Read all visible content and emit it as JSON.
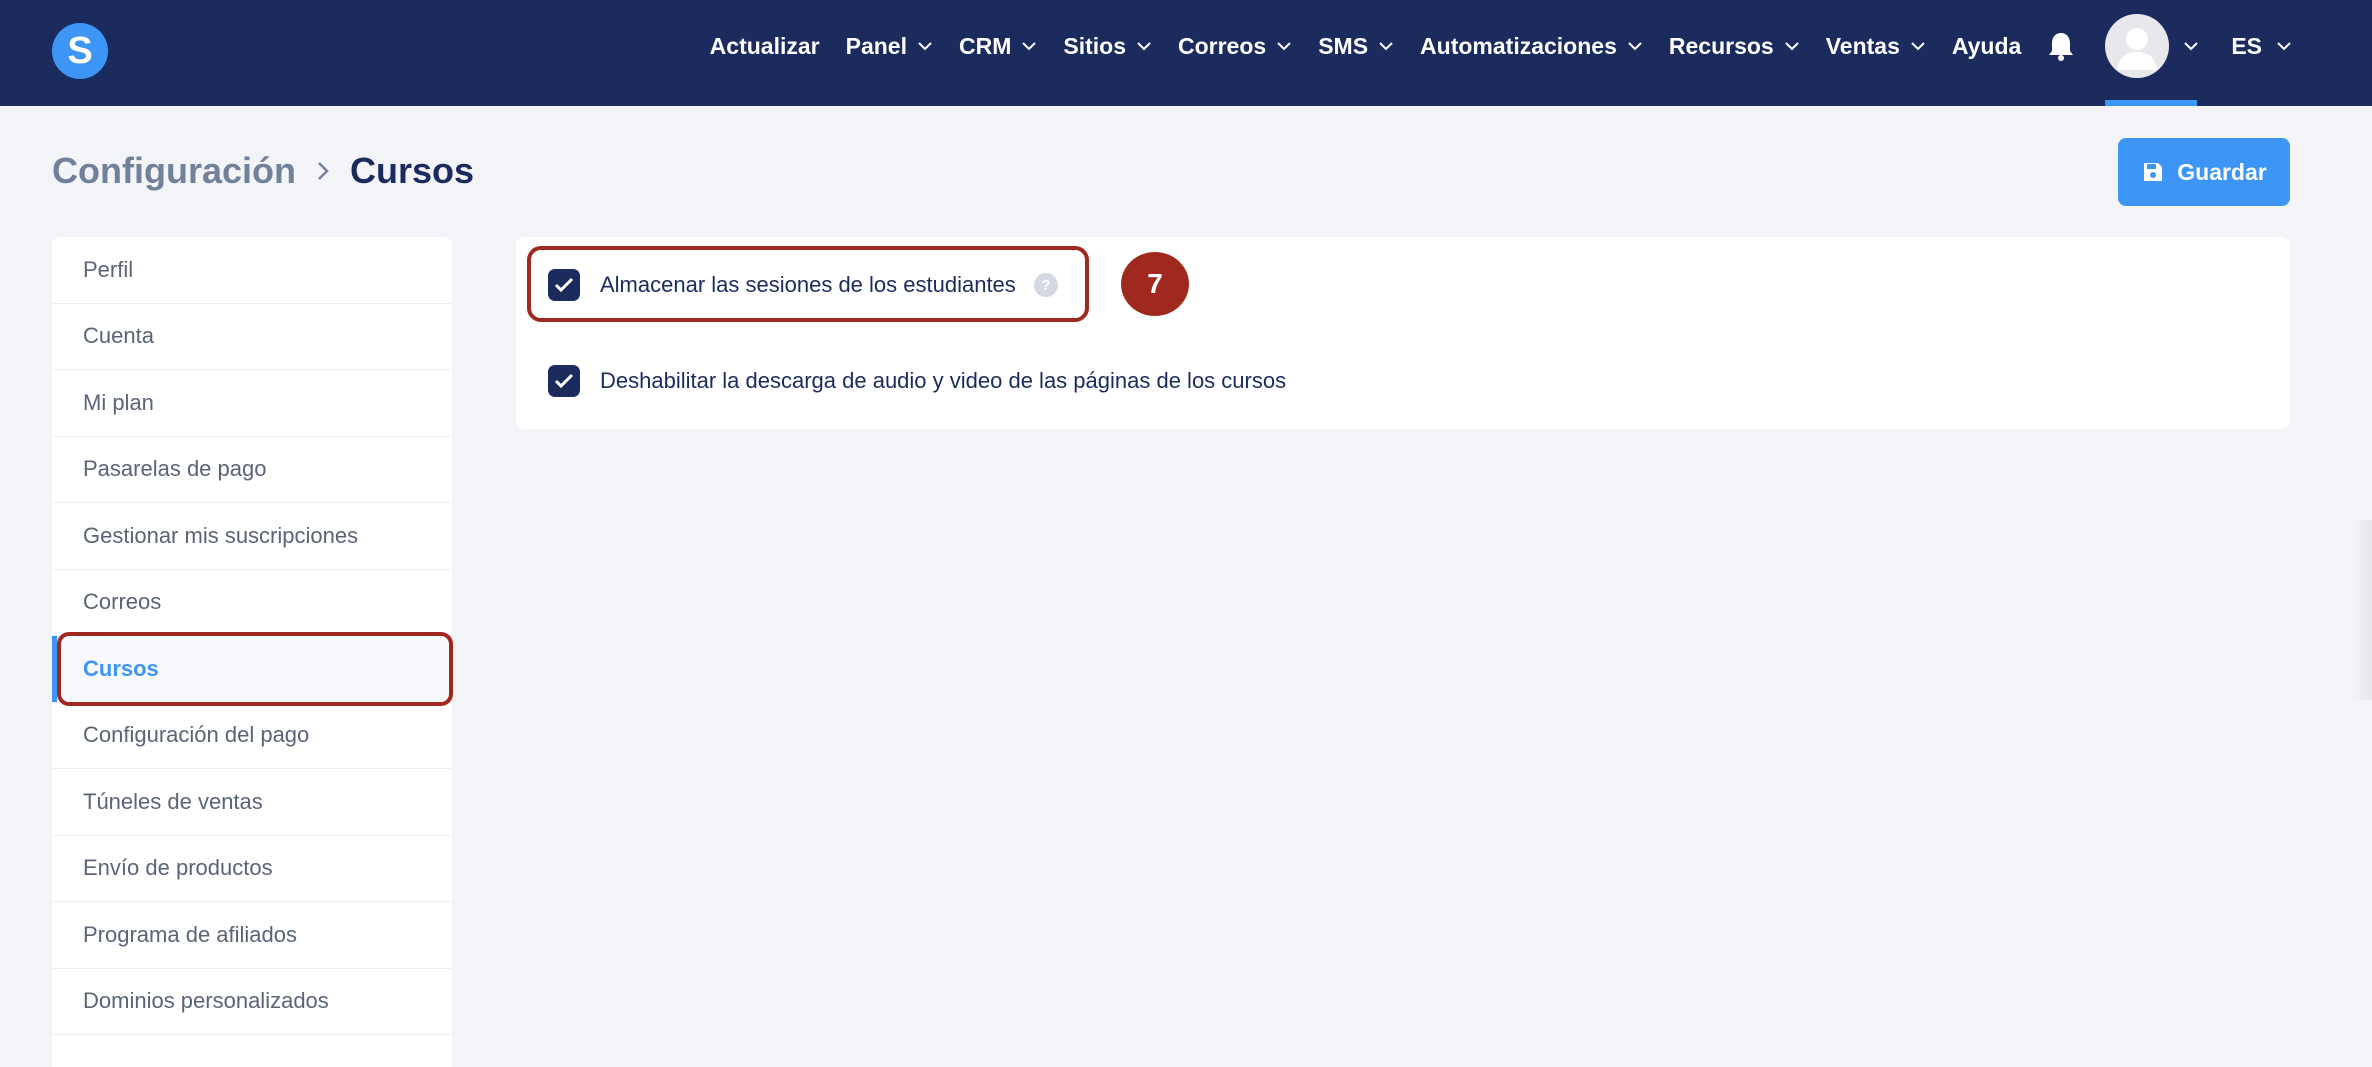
{
  "app": {
    "logo_letter": "S"
  },
  "navbar": {
    "items": [
      {
        "label": "Actualizar",
        "dropdown": false
      },
      {
        "label": "Panel",
        "dropdown": true
      },
      {
        "label": "CRM",
        "dropdown": true
      },
      {
        "label": "Sitios",
        "dropdown": true
      },
      {
        "label": "Correos",
        "dropdown": true
      },
      {
        "label": "SMS",
        "dropdown": true
      },
      {
        "label": "Automatizaciones",
        "dropdown": true
      },
      {
        "label": "Recursos",
        "dropdown": true
      },
      {
        "label": "Ventas",
        "dropdown": true
      },
      {
        "label": "Ayuda",
        "dropdown": false
      }
    ],
    "language": "ES"
  },
  "header": {
    "breadcrumb_parent": "Configuración",
    "breadcrumb_current": "Cursos",
    "save_label": "Guardar"
  },
  "sidebar": {
    "items": [
      {
        "label": "Perfil",
        "active": false
      },
      {
        "label": "Cuenta",
        "active": false
      },
      {
        "label": "Mi plan",
        "active": false
      },
      {
        "label": "Pasarelas de pago",
        "active": false
      },
      {
        "label": "Gestionar mis suscripciones",
        "active": false
      },
      {
        "label": "Correos",
        "active": false
      },
      {
        "label": "Cursos",
        "active": true
      },
      {
        "label": "Configuración del pago",
        "active": false
      },
      {
        "label": "Túneles de ventas",
        "active": false
      },
      {
        "label": "Envío de productos",
        "active": false
      },
      {
        "label": "Programa de afiliados",
        "active": false
      },
      {
        "label": "Dominios personalizados",
        "active": false
      }
    ]
  },
  "settings": {
    "options": [
      {
        "label": "Almacenar las sesiones de los estudiantes",
        "checked": true,
        "help": "?"
      },
      {
        "label": "Deshabilitar la descarga de audio y video de las páginas de los cursos",
        "checked": true
      }
    ]
  },
  "annotation": {
    "step": "7"
  },
  "colors": {
    "navbar": "#1b2b5e",
    "accent": "#3d96f5",
    "highlight": "#a0291f",
    "background": "#f3f4f8"
  }
}
